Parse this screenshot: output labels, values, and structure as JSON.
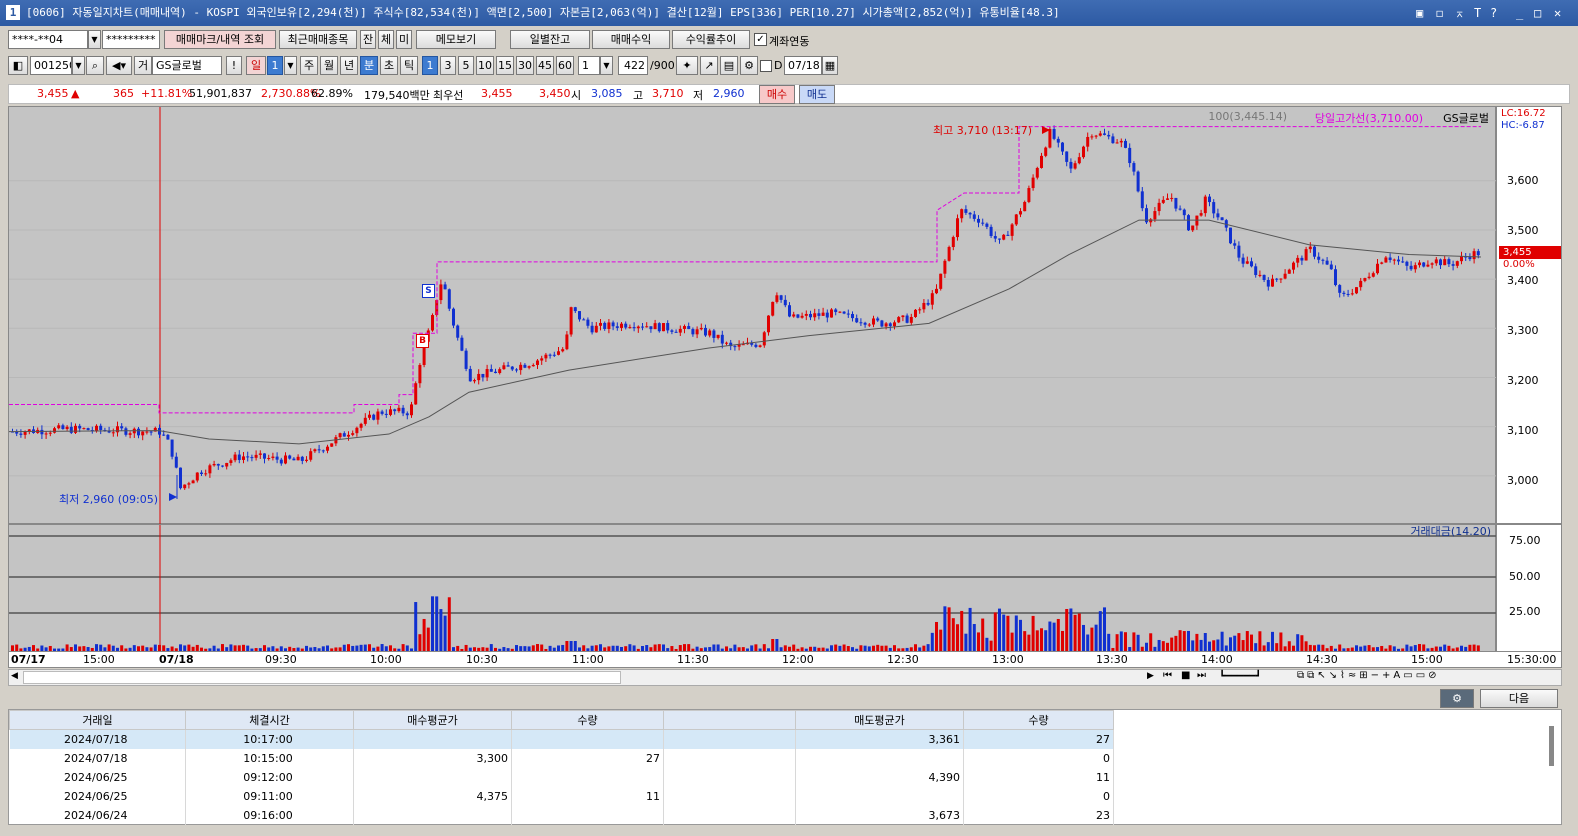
{
  "titlebar": {
    "num": "1",
    "title": "[0606] 자동일지차트(매매내역) - KOSPI 외국인보유[2,294(천)] 주식수[82,534(천)] 액면[2,500] 자본금[2,063(억)] 결산[12월] EPS[336] PER[10.27] 시가총액[2,852(억)] 유통비율[48.3]",
    "controls": [
      "▣",
      "◻",
      "⌅",
      "T",
      "?",
      "_",
      "□",
      "✕"
    ]
  },
  "toolbar1": {
    "account": "****-**04",
    "password": "*********",
    "btn_trade_mark": "매매마크/내역 조회",
    "btn_recent": "최근매매종목",
    "btn_jan": "잔",
    "btn_che": "체",
    "btn_mi": "미",
    "btn_memo": "메모보기",
    "btn_daily": "일별잔고",
    "btn_profit": "매매수익",
    "btn_rate": "수익률추이",
    "chk_link": "계좌연동"
  },
  "toolbar2": {
    "code": "001250",
    "market": "거",
    "name": "GS글로벌",
    "period_day": "일",
    "period_day_n": "1",
    "week": "주",
    "month": "월",
    "year": "년",
    "minute": "분",
    "second": "초",
    "tick": "틱",
    "intervals": [
      "1",
      "3",
      "5",
      "10",
      "15",
      "30",
      "45",
      "60"
    ],
    "interval_sel": "1",
    "count": "422",
    "count_max": "/900",
    "date_prefix": "D",
    "date": "07/18"
  },
  "quote": {
    "price": "3,455",
    "arrow": "▲",
    "change": "365",
    "change_pct": "+11.81%",
    "volume": "51,901,837",
    "vol_pct": "2,730.88%",
    "ratio": "62.89%",
    "amount": "179,540백만",
    "best_label": "최우선",
    "ask": "3,455",
    "bid": "3,450",
    "open_label": "시",
    "open": "3,085",
    "high_label": "고",
    "high": "3,710",
    "low_label": "저",
    "low": "2,960",
    "buy": "매수",
    "sell": "매도"
  },
  "chart": {
    "legend_ma": "100(3,445.14)",
    "legend_high": "당일고가선(3,710.00)",
    "legend_name": "GS글로벌",
    "lc": "LC:16.72",
    "hc": "HC:-6.87",
    "high_note": "최고 3,710 (13:17)",
    "low_note": "최저 2,960 (09:05)",
    "mark_s": "S",
    "mark_b": "B",
    "current_price": "3,455",
    "current_pct": "0.00%",
    "y_ticks": [
      "3,600",
      "3,500",
      "3,400",
      "3,300",
      "3,200",
      "3,100",
      "3,000"
    ],
    "vol_legend": "거래대금(14.20)",
    "vol_ticks": [
      "75.00",
      "50.00",
      "25.00"
    ],
    "x_ticks": [
      "07/17",
      "15:00",
      "07/18",
      "09:30",
      "10:00",
      "10:30",
      "11:00",
      "11:30",
      "12:00",
      "12:30",
      "13:00",
      "13:30",
      "14:00",
      "14:30",
      "15:00",
      "15:30:00"
    ]
  },
  "chart_data": {
    "type": "candlestick",
    "ylim": [
      2900,
      3750
    ],
    "prev_high": 3145,
    "day_high": 3710,
    "day_low": 2960,
    "current": 3455
  },
  "bottom": {
    "next": "다음"
  },
  "table": {
    "headers": [
      "거래일",
      "체결시간",
      "매수평균가",
      "수량",
      "",
      "매도평균가",
      "수량"
    ],
    "rows": [
      [
        "2024/07/18",
        "10:17:00",
        "",
        "",
        "",
        "3,361",
        "27"
      ],
      [
        "2024/07/18",
        "10:15:00",
        "3,300",
        "27",
        "",
        "",
        "0"
      ],
      [
        "2024/06/25",
        "09:12:00",
        "",
        "",
        "",
        "4,390",
        "11"
      ],
      [
        "2024/06/25",
        "09:11:00",
        "4,375",
        "11",
        "",
        "",
        "0"
      ],
      [
        "2024/06/24",
        "09:16:00",
        "",
        "",
        "",
        "3,673",
        "23"
      ]
    ]
  }
}
